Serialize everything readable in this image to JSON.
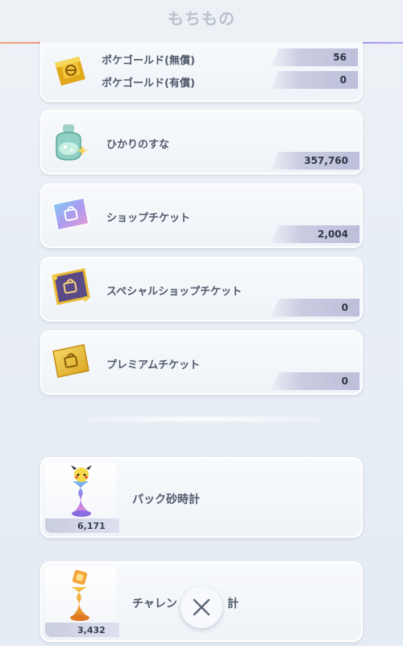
{
  "header": {
    "title": "もちもの"
  },
  "items": {
    "pokegold": {
      "free_label": "ポケゴールド(無償)",
      "free_value": "56",
      "paid_label": "ポケゴールド(有償)",
      "paid_value": "0"
    },
    "shining_sand": {
      "label": "ひかりのすな",
      "value": "357,760"
    },
    "shop_ticket": {
      "label": "ショップチケット",
      "value": "2,004"
    },
    "special_shop_ticket": {
      "label": "スペシャルショップチケット",
      "value": "0"
    },
    "premium_ticket": {
      "label": "プレミアムチケット",
      "value": "0"
    }
  },
  "hourglasses": {
    "pack": {
      "label": "パック砂時計",
      "count": "6,171"
    },
    "challenge": {
      "label_left": "チャレン",
      "label_right": "計",
      "count": "3,432"
    }
  },
  "close": {
    "icon": "close-icon"
  }
}
